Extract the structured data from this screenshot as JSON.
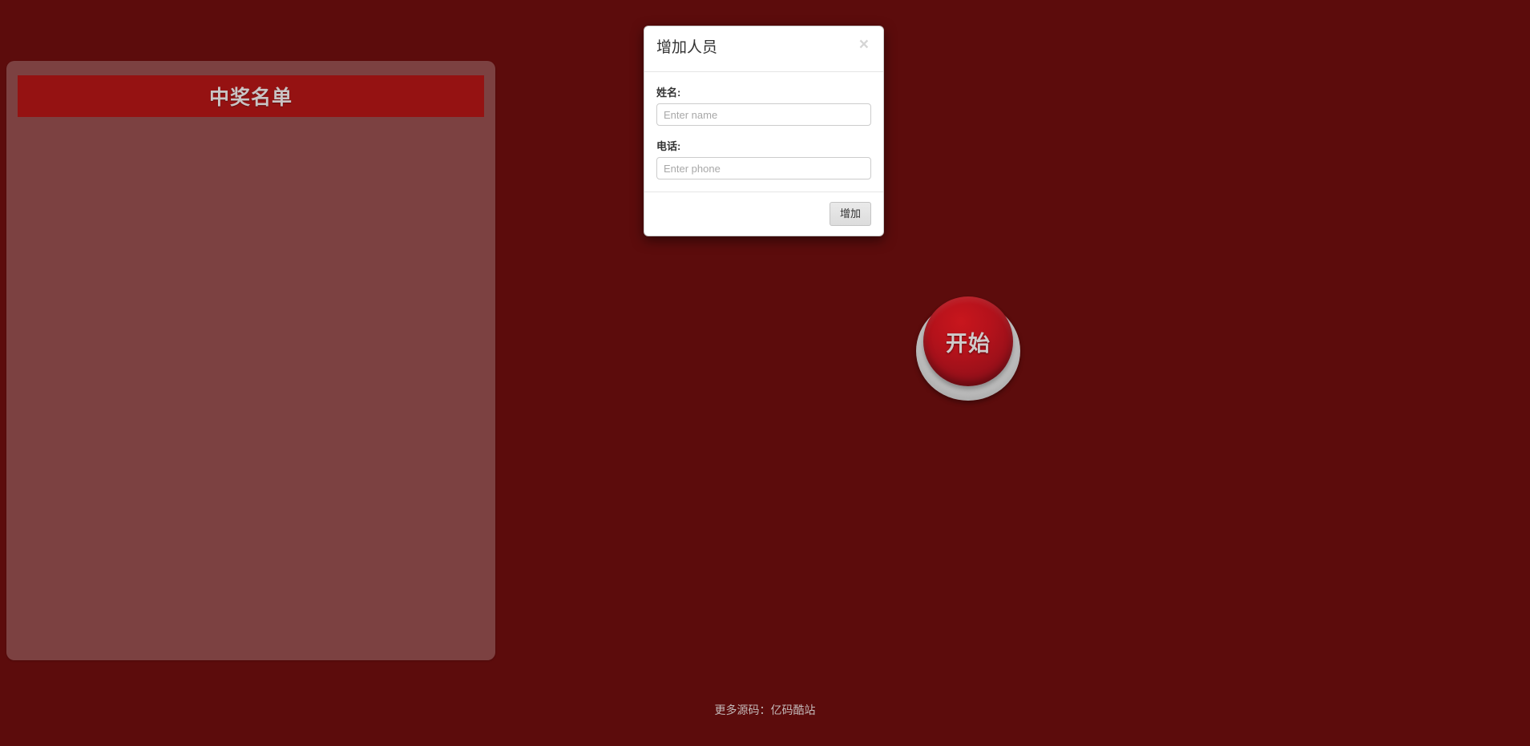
{
  "theme": {
    "background_color": "#5c0c0c",
    "background_center_color": "#7d2a2a",
    "panel_header_color": "#951212",
    "accent_text_color": "#c9c4c4",
    "button_red": "#b5121b",
    "button_base_gray": "#c6c6c6"
  },
  "winner_panel": {
    "title": "中奖名单",
    "items": []
  },
  "start_button": {
    "label": "开始"
  },
  "modal": {
    "title": "增加人员",
    "close_label": "×",
    "fields": [
      {
        "label": "姓名:",
        "placeholder": "Enter name",
        "value": ""
      },
      {
        "label": "电话:",
        "placeholder": "Enter phone",
        "value": ""
      }
    ],
    "submit_label": "增加"
  },
  "footer": {
    "prefix": "更多源码：",
    "link_text": "亿码酷站"
  }
}
